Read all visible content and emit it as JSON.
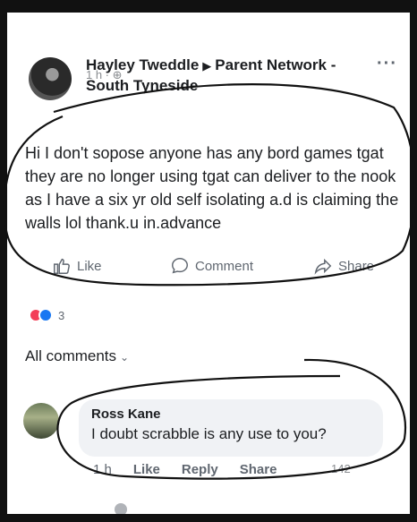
{
  "post": {
    "author": "Hayley Tweddle",
    "group": "Parent Network - South Tyneside",
    "time": "1 h ·",
    "text": "Hi I don't sopose anyone has any bord games tgat they are no longer using tgat can deliver to the nook as I have a six yr old self isolating a.d is claiming the walls lol  thank.u in.advance",
    "more_icon": "···"
  },
  "actions": {
    "like": "Like",
    "comment": "Comment",
    "share": "Share"
  },
  "reactions": {
    "count": "3"
  },
  "comments_filter": "All comments",
  "comment": {
    "author": "Ross Kane",
    "text": "I doubt scrabble is any use to you?",
    "time": "1 h",
    "like": "Like",
    "reply": "Reply",
    "share": "Share",
    "like_count": "142"
  },
  "colors": {
    "link": "#1877f2",
    "text": "#1c1e21",
    "secondary": "#606770",
    "bubble": "#f0f2f5"
  }
}
